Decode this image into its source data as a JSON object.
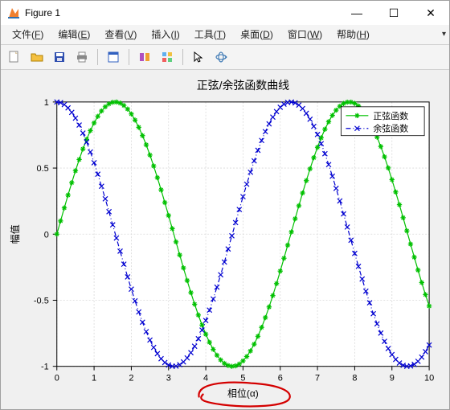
{
  "window": {
    "title": "Figure 1",
    "controls": {
      "min": "—",
      "max": "☐",
      "close": "✕"
    }
  },
  "menubar": {
    "items": [
      {
        "label": "文件",
        "mnemonic": "F"
      },
      {
        "label": "编辑",
        "mnemonic": "E"
      },
      {
        "label": "查看",
        "mnemonic": "V"
      },
      {
        "label": "插入",
        "mnemonic": "I"
      },
      {
        "label": "工具",
        "mnemonic": "T"
      },
      {
        "label": "桌面",
        "mnemonic": "D"
      },
      {
        "label": "窗口",
        "mnemonic": "W"
      },
      {
        "label": "帮助",
        "mnemonic": "H"
      }
    ],
    "overflow_glyph": "▾"
  },
  "toolbar": {
    "buttons": [
      "new-figure-icon",
      "open-icon",
      "save-icon",
      "print-icon",
      "sep",
      "edit-plot-icon",
      "sep",
      "link-brush-icon",
      "data-tip-icon",
      "sep",
      "pointer-icon",
      "rotate-3d-icon"
    ]
  },
  "chart_data": {
    "type": "line",
    "title": "正弦/余弦函数曲线",
    "xlabel": "相位(α)",
    "ylabel": "幅值",
    "xlim": [
      0,
      10
    ],
    "ylim": [
      -1,
      1
    ],
    "xticks": [
      0,
      1,
      2,
      3,
      4,
      5,
      6,
      7,
      8,
      9,
      10
    ],
    "yticks": [
      -1,
      -0.5,
      0,
      0.5,
      1
    ],
    "grid": true,
    "legend": {
      "position": "northeast",
      "entries": [
        "正弦函数",
        "余弦函数"
      ]
    },
    "x": [
      0,
      0.1,
      0.2,
      0.3,
      0.4,
      0.5,
      0.6,
      0.7,
      0.8,
      0.9,
      1.0,
      1.1,
      1.2,
      1.3,
      1.4,
      1.5,
      1.6,
      1.7,
      1.8,
      1.9,
      2.0,
      2.1,
      2.2,
      2.3,
      2.4,
      2.5,
      2.6,
      2.7,
      2.8,
      2.9,
      3.0,
      3.1,
      3.2,
      3.3,
      3.4,
      3.5,
      3.6,
      3.7,
      3.8,
      3.9,
      4.0,
      4.1,
      4.2,
      4.3,
      4.4,
      4.5,
      4.6,
      4.7,
      4.8,
      4.9,
      5.0,
      5.1,
      5.2,
      5.3,
      5.4,
      5.5,
      5.6,
      5.7,
      5.8,
      5.9,
      6.0,
      6.1,
      6.2,
      6.3,
      6.4,
      6.5,
      6.6,
      6.7,
      6.8,
      6.9,
      7.0,
      7.1,
      7.2,
      7.3,
      7.4,
      7.5,
      7.6,
      7.7,
      7.8,
      7.9,
      8.0,
      8.1,
      8.2,
      8.3,
      8.4,
      8.5,
      8.6,
      8.7,
      8.8,
      8.9,
      9.0,
      9.1,
      9.2,
      9.3,
      9.4,
      9.5,
      9.6,
      9.7,
      9.8,
      9.9,
      10.0
    ],
    "series": [
      {
        "name": "正弦函数",
        "marker": "*",
        "color": "#00c000",
        "values": [
          0.0,
          0.0998,
          0.1987,
          0.2955,
          0.3894,
          0.4794,
          0.5646,
          0.6442,
          0.7174,
          0.7833,
          0.8415,
          0.8912,
          0.932,
          0.9636,
          0.9854,
          0.9975,
          0.9996,
          0.9917,
          0.9738,
          0.9463,
          0.9093,
          0.8632,
          0.8085,
          0.7457,
          0.6755,
          0.5985,
          0.5155,
          0.4274,
          0.335,
          0.2392,
          0.1411,
          0.0416,
          -0.0584,
          -0.1577,
          -0.2555,
          -0.3508,
          -0.4425,
          -0.5298,
          -0.6119,
          -0.6878,
          -0.7568,
          -0.8183,
          -0.8716,
          -0.9162,
          -0.9516,
          -0.9775,
          -0.9937,
          -0.9999,
          -0.9962,
          -0.9825,
          -0.9589,
          -0.9258,
          -0.8835,
          -0.8323,
          -0.7728,
          -0.7055,
          -0.6313,
          -0.5507,
          -0.4646,
          -0.3739,
          -0.2794,
          -0.1822,
          -0.0831,
          0.0168,
          0.1165,
          0.2151,
          0.3115,
          0.4048,
          0.4941,
          0.5784,
          0.657,
          0.729,
          0.7937,
          0.8504,
          0.8987,
          0.938,
          0.9679,
          0.9882,
          0.9985,
          0.9989,
          0.9894,
          0.9699,
          0.9407,
          0.9022,
          0.8546,
          0.7985,
          0.7344,
          0.663,
          0.585,
          0.501,
          0.4121,
          0.3191,
          0.2229,
          0.1245,
          0.0248,
          -0.0752,
          -0.1743,
          -0.2718,
          -0.3665,
          -0.4575,
          -0.544
        ]
      },
      {
        "name": "余弦函数",
        "marker": "x",
        "color": "#0000d0",
        "values": [
          1.0,
          0.995,
          0.9801,
          0.9553,
          0.9211,
          0.8776,
          0.8253,
          0.7648,
          0.6967,
          0.6216,
          0.5403,
          0.4536,
          0.3624,
          0.2675,
          0.17,
          0.0707,
          -0.0292,
          -0.1288,
          -0.2272,
          -0.3233,
          -0.4161,
          -0.5048,
          -0.5885,
          -0.6663,
          -0.7374,
          -0.8011,
          -0.8569,
          -0.9041,
          -0.9422,
          -0.971,
          -0.99,
          -0.9991,
          -0.9983,
          -0.9875,
          -0.9668,
          -0.9365,
          -0.8968,
          -0.8481,
          -0.791,
          -0.7259,
          -0.6536,
          -0.5748,
          -0.4903,
          -0.4008,
          -0.3073,
          -0.2108,
          -0.1122,
          -0.0124,
          0.0875,
          0.1865,
          0.2837,
          0.378,
          0.4685,
          0.5544,
          0.6347,
          0.7087,
          0.7756,
          0.8347,
          0.8855,
          0.9275,
          0.9602,
          0.9833,
          0.9965,
          0.9999,
          0.9932,
          0.9766,
          0.9502,
          0.9144,
          0.8694,
          0.8157,
          0.7539,
          0.6845,
          0.6084,
          0.5261,
          0.4385,
          0.3466,
          0.2513,
          0.1534,
          0.054,
          -0.046,
          -0.1455,
          -0.2435,
          -0.3392,
          -0.4314,
          -0.5193,
          -0.602,
          -0.6787,
          -0.7486,
          -0.8111,
          -0.8654,
          -0.9111,
          -0.9477,
          -0.9748,
          -0.9922,
          -0.9997,
          -0.9972,
          -0.9847,
          -0.9624,
          -0.9304,
          -0.8892,
          -0.8391
        ]
      }
    ]
  }
}
